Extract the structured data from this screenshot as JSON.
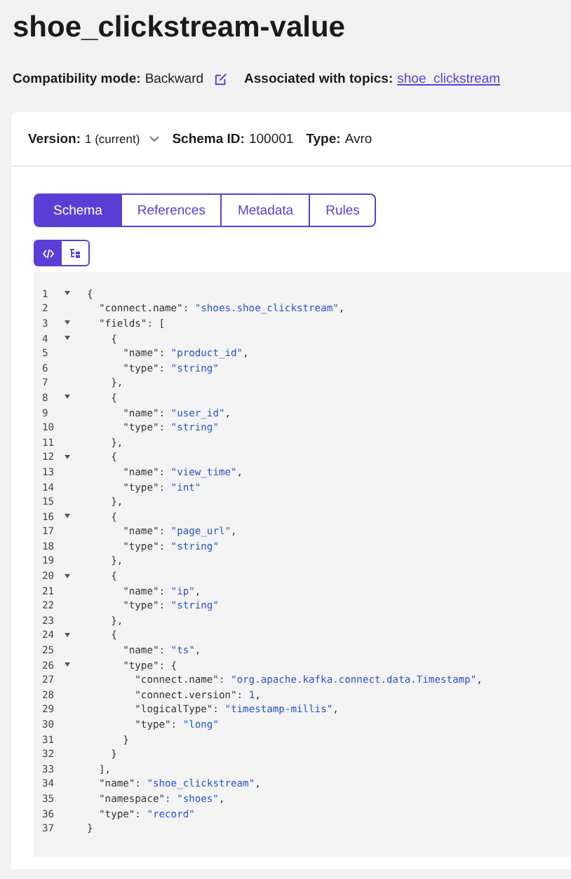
{
  "title": "shoe_clickstream-value",
  "info": [
    {
      "label": "Compatibility mode:",
      "value": "Backward",
      "kind": "edit"
    },
    {
      "label": "Associated with topics:",
      "value": "shoe_clickstream",
      "kind": "link"
    }
  ],
  "meta": [
    {
      "label": "Version:",
      "value": "1 (current)",
      "kind": "dropdown"
    },
    {
      "label": "Schema ID:",
      "value": "100001",
      "kind": "text"
    },
    {
      "label": "Type:",
      "value": "Avro",
      "kind": "text"
    }
  ],
  "tabs": [
    {
      "label": "Schema",
      "selected": true
    },
    {
      "label": "References",
      "selected": false
    },
    {
      "label": "Metadata",
      "selected": false
    },
    {
      "label": "Rules",
      "selected": false
    }
  ],
  "view_toggle": [
    {
      "kind": "code",
      "selected": true
    },
    {
      "kind": "tree",
      "selected": false
    }
  ],
  "code": [
    {
      "number": "1",
      "foldable": true,
      "parts": [
        {
          "kind": "punct",
          "text": "{"
        }
      ]
    },
    {
      "number": "2",
      "foldable": false,
      "parts": [
        {
          "kind": "punct",
          "text": "  \"connect.name\": "
        },
        {
          "kind": "string",
          "text": "\"shoes.shoe_clickstream\""
        },
        {
          "kind": "punct",
          "text": ","
        }
      ]
    },
    {
      "number": "3",
      "foldable": true,
      "parts": [
        {
          "kind": "punct",
          "text": "  \"fields\": ["
        }
      ]
    },
    {
      "number": "4",
      "foldable": true,
      "parts": [
        {
          "kind": "punct",
          "text": "    {"
        }
      ]
    },
    {
      "number": "5",
      "foldable": false,
      "parts": [
        {
          "kind": "punct",
          "text": "      \"name\": "
        },
        {
          "kind": "string",
          "text": "\"product_id\""
        },
        {
          "kind": "punct",
          "text": ","
        }
      ]
    },
    {
      "number": "6",
      "foldable": false,
      "parts": [
        {
          "kind": "punct",
          "text": "      \"type\": "
        },
        {
          "kind": "string",
          "text": "\"string\""
        }
      ]
    },
    {
      "number": "7",
      "foldable": false,
      "parts": [
        {
          "kind": "punct",
          "text": "    },"
        }
      ]
    },
    {
      "number": "8",
      "foldable": true,
      "parts": [
        {
          "kind": "punct",
          "text": "    {"
        }
      ]
    },
    {
      "number": "9",
      "foldable": false,
      "parts": [
        {
          "kind": "punct",
          "text": "      \"name\": "
        },
        {
          "kind": "string",
          "text": "\"user_id\""
        },
        {
          "kind": "punct",
          "text": ","
        }
      ]
    },
    {
      "number": "10",
      "foldable": false,
      "parts": [
        {
          "kind": "punct",
          "text": "      \"type\": "
        },
        {
          "kind": "string",
          "text": "\"string\""
        }
      ]
    },
    {
      "number": "11",
      "foldable": false,
      "parts": [
        {
          "kind": "punct",
          "text": "    },"
        }
      ]
    },
    {
      "number": "12",
      "foldable": true,
      "parts": [
        {
          "kind": "punct",
          "text": "    {"
        }
      ]
    },
    {
      "number": "13",
      "foldable": false,
      "parts": [
        {
          "kind": "punct",
          "text": "      \"name\": "
        },
        {
          "kind": "string",
          "text": "\"view_time\""
        },
        {
          "kind": "punct",
          "text": ","
        }
      ]
    },
    {
      "number": "14",
      "foldable": false,
      "parts": [
        {
          "kind": "punct",
          "text": "      \"type\": "
        },
        {
          "kind": "string",
          "text": "\"int\""
        }
      ]
    },
    {
      "number": "15",
      "foldable": false,
      "parts": [
        {
          "kind": "punct",
          "text": "    },"
        }
      ]
    },
    {
      "number": "16",
      "foldable": true,
      "parts": [
        {
          "kind": "punct",
          "text": "    {"
        }
      ]
    },
    {
      "number": "17",
      "foldable": false,
      "parts": [
        {
          "kind": "punct",
          "text": "      \"name\": "
        },
        {
          "kind": "string",
          "text": "\"page_url\""
        },
        {
          "kind": "punct",
          "text": ","
        }
      ]
    },
    {
      "number": "18",
      "foldable": false,
      "parts": [
        {
          "kind": "punct",
          "text": "      \"type\": "
        },
        {
          "kind": "string",
          "text": "\"string\""
        }
      ]
    },
    {
      "number": "19",
      "foldable": false,
      "parts": [
        {
          "kind": "punct",
          "text": "    },"
        }
      ]
    },
    {
      "number": "20",
      "foldable": true,
      "parts": [
        {
          "kind": "punct",
          "text": "    {"
        }
      ]
    },
    {
      "number": "21",
      "foldable": false,
      "parts": [
        {
          "kind": "punct",
          "text": "      \"name\": "
        },
        {
          "kind": "string",
          "text": "\"ip\""
        },
        {
          "kind": "punct",
          "text": ","
        }
      ]
    },
    {
      "number": "22",
      "foldable": false,
      "parts": [
        {
          "kind": "punct",
          "text": "      \"type\": "
        },
        {
          "kind": "string",
          "text": "\"string\""
        }
      ]
    },
    {
      "number": "23",
      "foldable": false,
      "parts": [
        {
          "kind": "punct",
          "text": "    },"
        }
      ]
    },
    {
      "number": "24",
      "foldable": true,
      "parts": [
        {
          "kind": "punct",
          "text": "    {"
        }
      ]
    },
    {
      "number": "25",
      "foldable": false,
      "parts": [
        {
          "kind": "punct",
          "text": "      \"name\": "
        },
        {
          "kind": "string",
          "text": "\"ts\""
        },
        {
          "kind": "punct",
          "text": ","
        }
      ]
    },
    {
      "number": "26",
      "foldable": true,
      "parts": [
        {
          "kind": "punct",
          "text": "      \"type\": {"
        }
      ]
    },
    {
      "number": "27",
      "foldable": false,
      "parts": [
        {
          "kind": "punct",
          "text": "        \"connect.name\": "
        },
        {
          "kind": "string",
          "text": "\"org.apache.kafka.connect.data.Timestamp\""
        },
        {
          "kind": "punct",
          "text": ","
        }
      ]
    },
    {
      "number": "28",
      "foldable": false,
      "parts": [
        {
          "kind": "punct",
          "text": "        \"connect.version\": "
        },
        {
          "kind": "number",
          "text": "1"
        },
        {
          "kind": "punct",
          "text": ","
        }
      ]
    },
    {
      "number": "29",
      "foldable": false,
      "parts": [
        {
          "kind": "punct",
          "text": "        \"logicalType\": "
        },
        {
          "kind": "string",
          "text": "\"timestamp-millis\""
        },
        {
          "kind": "punct",
          "text": ","
        }
      ]
    },
    {
      "number": "30",
      "foldable": false,
      "parts": [
        {
          "kind": "punct",
          "text": "        \"type\": "
        },
        {
          "kind": "string",
          "text": "\"long\""
        }
      ]
    },
    {
      "number": "31",
      "foldable": false,
      "parts": [
        {
          "kind": "punct",
          "text": "      }"
        }
      ]
    },
    {
      "number": "32",
      "foldable": false,
      "parts": [
        {
          "kind": "punct",
          "text": "    }"
        }
      ]
    },
    {
      "number": "33",
      "foldable": false,
      "parts": [
        {
          "kind": "punct",
          "text": "  ],"
        }
      ]
    },
    {
      "number": "34",
      "foldable": false,
      "parts": [
        {
          "kind": "punct",
          "text": "  \"name\": "
        },
        {
          "kind": "string",
          "text": "\"shoe_clickstream\""
        },
        {
          "kind": "punct",
          "text": ","
        }
      ]
    },
    {
      "number": "35",
      "foldable": false,
      "parts": [
        {
          "kind": "punct",
          "text": "  \"namespace\": "
        },
        {
          "kind": "string",
          "text": "\"shoes\""
        },
        {
          "kind": "punct",
          "text": ","
        }
      ]
    },
    {
      "number": "36",
      "foldable": false,
      "parts": [
        {
          "kind": "punct",
          "text": "  \"type\": "
        },
        {
          "kind": "string",
          "text": "\"record\""
        }
      ]
    },
    {
      "number": "37",
      "foldable": false,
      "parts": [
        {
          "kind": "punct",
          "text": "}"
        }
      ]
    }
  ]
}
